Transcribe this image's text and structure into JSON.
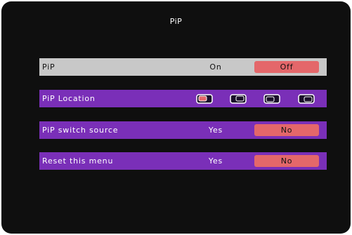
{
  "menu": {
    "title": "PiP",
    "rows": [
      {
        "label": "PiP",
        "options": [
          "On",
          "Off"
        ],
        "selected": "Off"
      },
      {
        "label": "PiP Location",
        "icons": [
          "location-top-left-icon",
          "location-top-right-icon",
          "location-bottom-left-icon",
          "location-bottom-right-icon"
        ],
        "selected_index": 0
      },
      {
        "label": "PiP switch source",
        "options": [
          "Yes",
          "No"
        ],
        "selected": "No"
      },
      {
        "label": "Reset this menu",
        "options": [
          "Yes",
          "No"
        ],
        "selected": "No"
      }
    ]
  },
  "colors": {
    "background": "#0f0f0f",
    "row_highlight": "#c8c8c8",
    "row_normal": "#7a2fb8",
    "selected_option": "#e4676a",
    "location_icon_fill": "#1a0f2a",
    "location_icon_active_fill": "#e4676a",
    "location_icon_outline": "#ffffff"
  }
}
